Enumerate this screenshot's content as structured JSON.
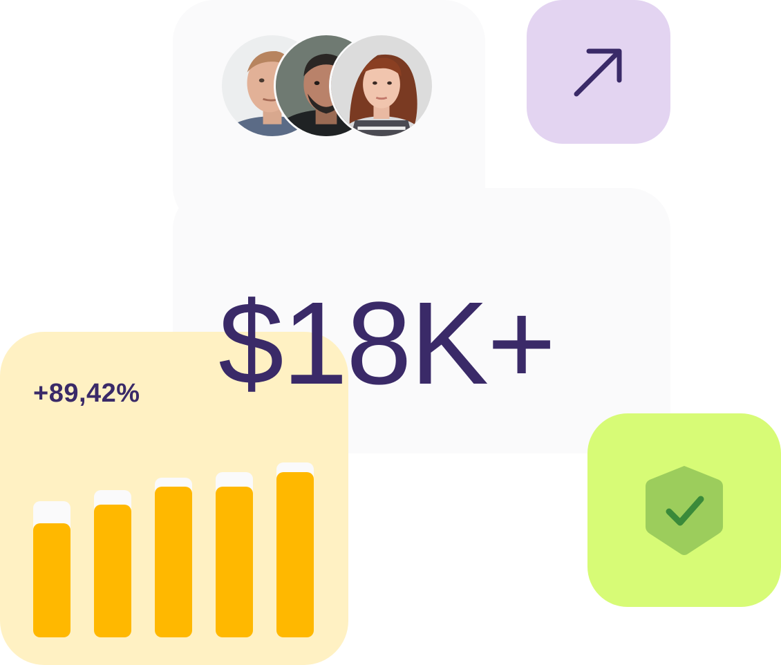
{
  "stats": {
    "total_value": "$18K+",
    "growth_value": "+89,42%"
  },
  "avatars": [
    {
      "name": "avatar-1",
      "icon": "person-photo"
    },
    {
      "name": "avatar-2",
      "icon": "person-photo"
    },
    {
      "name": "avatar-3",
      "icon": "person-photo"
    }
  ],
  "tiles": {
    "arrow_icon": "arrow-up-right-icon",
    "shield_icon": "shield-check-icon"
  },
  "colors": {
    "text_primary": "#3a2a68",
    "card_bg": "#fafafb",
    "tile_purple": "#e3d4f1",
    "tile_green": "#d7fb76",
    "card_yellow": "#fff1c3",
    "bar_fill": "#ffb800",
    "shield_fill": "#9ccd5c",
    "check_color": "#3a8a3a"
  },
  "chart_data": {
    "type": "bar",
    "categories": [
      "",
      "",
      "",
      "",
      ""
    ],
    "values": [
      0.62,
      0.72,
      0.82,
      0.82,
      0.9
    ],
    "max": [
      0.74,
      0.8,
      0.87,
      0.9,
      0.95
    ],
    "title": "",
    "xlabel": "",
    "ylabel": "",
    "ylim": [
      0,
      1
    ],
    "grid": false,
    "legend": "none"
  }
}
